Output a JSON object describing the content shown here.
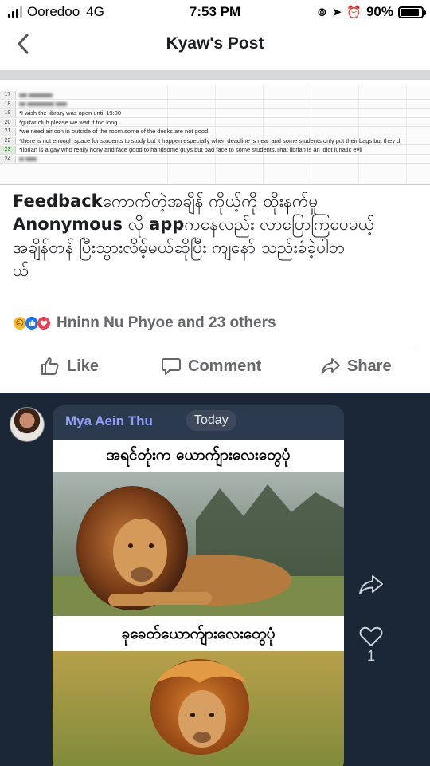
{
  "status_bar": {
    "carrier": "Ooredoo",
    "network": "4G",
    "time": "7:53 PM",
    "battery": "90%",
    "battery_level": 0.9
  },
  "nav": {
    "title": "Kyaw's Post",
    "back_icon": "chevron-left-icon"
  },
  "spreadsheet": {
    "rows": [
      {
        "num": "17",
        "text": ""
      },
      {
        "num": "18",
        "text": ""
      },
      {
        "num": "19",
        "text": "*I wish the library was open until 19:00"
      },
      {
        "num": "20",
        "text": "*guitar club please.we wait it too long"
      },
      {
        "num": "21",
        "text": "*we need air con in outside of the room.some of the desks are not good"
      },
      {
        "num": "22",
        "text": "*there is not enough space for students to study but it happen especially when deadline is near and some students only put their bags but they d"
      },
      {
        "num": "23",
        "text": "*librian is a gay who really hony and face good to handsome guys but bad face to some students.That librian is an idiot lunatic evil"
      },
      {
        "num": "24",
        "text": ""
      }
    ]
  },
  "post": {
    "text_line1_bold": "Feedback",
    "text_line1_rest": "ကောက်တဲ့အချိန် ကိုယ့်ကို ထိုးနက်မှု",
    "text_line2_bold": "Anonymous",
    "text_line2_mid": " လို ",
    "text_line2_bold2": "app",
    "text_line2_rest": "ကနေလည်း လာပြောကြပေမယ့်",
    "text_line3": "အချိန်တန် ပြီးသွားလိမ့်မယ်ဆိုပြီး ကျနော် သည်းခံခဲ့ပါတ",
    "text_line4": "ယ်",
    "reactions_text": "Hninn Nu Phyoe and 23 others",
    "reaction_icons": [
      "sad-reaction-icon",
      "like-reaction-icon",
      "love-reaction-icon"
    ]
  },
  "actions": {
    "like": "Like",
    "comment": "Comment",
    "share": "Share"
  },
  "shared_image": {
    "sender": "Mya Aein Thu",
    "date_badge": "Today",
    "caption_top": "အရင်တုံးက ယောက်ျားလေးတွေပုံ",
    "caption_bottom": "ခုခေတ်ယောက်ျားလေးတွေပုံ",
    "like_count": "1"
  },
  "colors": {
    "facebook_gray_text": "#65676b",
    "chat_background": "#1b2737",
    "bubble": "#2c3a4e",
    "sender_name": "#8e9ef4",
    "like_blue": "#1877f2",
    "love_red": "#f33e58"
  }
}
